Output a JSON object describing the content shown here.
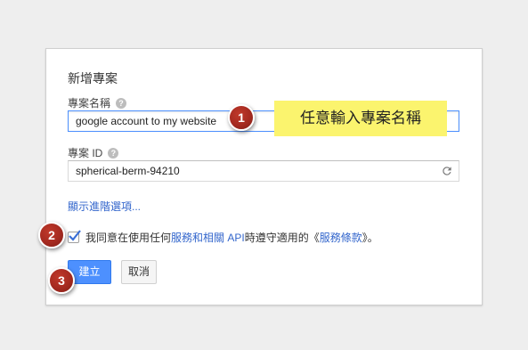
{
  "dialog": {
    "title": "新增專案",
    "project_name": {
      "label": "專案名稱",
      "value": "google account to my website"
    },
    "project_id": {
      "label": "專案 ID",
      "value": "spherical-berm-94210"
    },
    "advanced_link": "顯示進階選項...",
    "agree": {
      "checked": true,
      "text_before": "我同意在使用任何",
      "link_services": "服務和相關 API",
      "text_middle": " 時遵守適用的《",
      "link_terms": "服務條款",
      "text_after": "》。"
    },
    "create_button": "建立",
    "cancel_button": "取消"
  },
  "annotations": {
    "step1": "1",
    "step2": "2",
    "step3": "3",
    "note": "任意輸入專案名稱"
  },
  "colors": {
    "primary_button": "#4d90fe",
    "link": "#3366cc",
    "callout": "#a52a20",
    "note_background": "#fbf46e"
  }
}
